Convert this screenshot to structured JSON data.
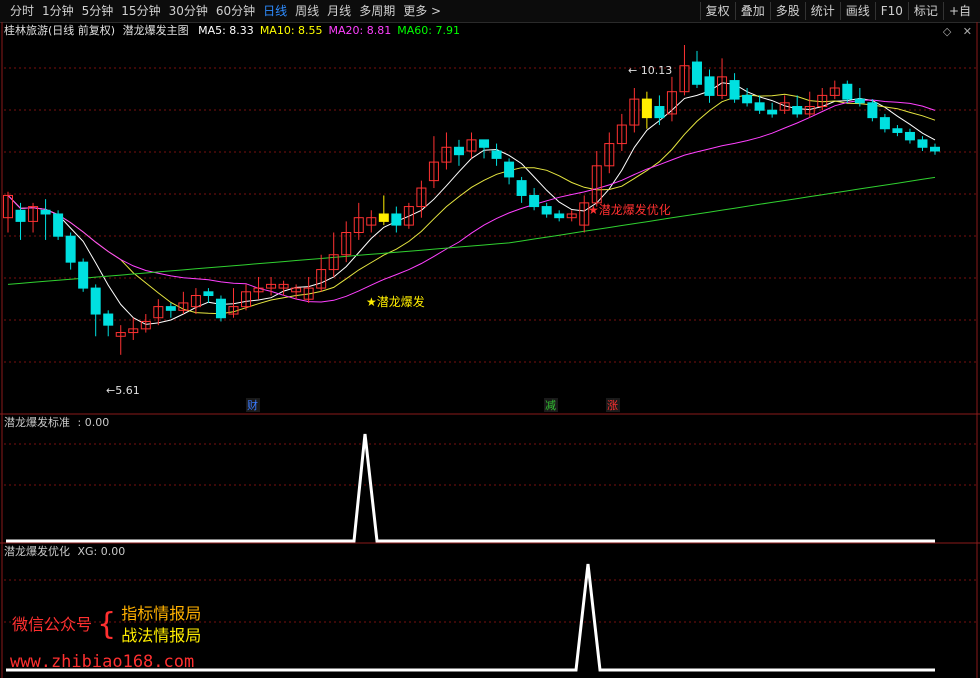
{
  "toolbar": {
    "periods": [
      "分时",
      "1分钟",
      "5分钟",
      "15分钟",
      "30分钟",
      "60分钟",
      "日线",
      "周线",
      "月线",
      "多周期",
      "更多 >"
    ],
    "active_period": "日线",
    "buttons": [
      "复权",
      "叠加",
      "多股",
      "统计",
      "画线",
      "F10",
      "标记",
      "+自"
    ]
  },
  "main_panel": {
    "stock": "桂林旅游(日线 前复权)",
    "indicator_name": "潜龙爆发主图",
    "ma": [
      {
        "label": "MA5: 8.33",
        "color": "#ffffff"
      },
      {
        "label": "MA10: 8.55",
        "color": "#ffff00"
      },
      {
        "label": "MA20: 8.81",
        "color": "#ff40ff"
      },
      {
        "label": "MA60: 7.91",
        "color": "#00ff00"
      }
    ],
    "high_label": "10.13",
    "low_label": "5.61",
    "signal1": "潜龙爆发",
    "signal2": "潜龙爆发优化",
    "markers": {
      "cai": "财",
      "jian": "减",
      "zhang": "涨"
    }
  },
  "panel2": {
    "title": "潜龙爆发标准",
    "value": ": 0.00"
  },
  "panel3": {
    "title": "潜龙爆发优化",
    "value": "XG: 0.00"
  },
  "watermark": {
    "wechat_label": "微信公众号",
    "line1": "指标情报局",
    "line2": "战法情报局",
    "website": "www.zhibiao168.com"
  },
  "colors": {
    "up": "#ff3232",
    "down": "#00e0e0",
    "signal": "#ffee00",
    "grid": "#7a1010"
  },
  "chart_data": {
    "type": "candlestick",
    "high": 10.13,
    "low": 5.61,
    "ma_values": {
      "MA5": 8.33,
      "MA10": 8.55,
      "MA20": 8.81,
      "MA60": 7.91
    }
  }
}
